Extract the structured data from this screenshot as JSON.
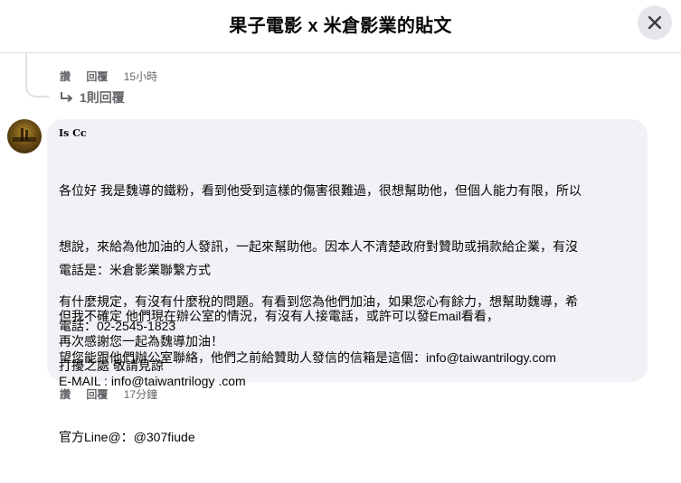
{
  "header": {
    "title": "果子電影 x 米倉影業的貼文"
  },
  "previous_comment": {
    "like_label": "讚",
    "reply_label": "回覆",
    "time": "15小時",
    "replies_link": "1則回覆"
  },
  "comment": {
    "author": "Is Cc",
    "paragraph1_lines": [
      "各位好 我是魏導的鐵粉，看到他受到這樣的傷害很難過，很想幫助他，但個人能力有限，所以",
      "想說，來給為他加油的人發訊，一起來幫助他。因本人不清楚政府對贊助或捐款給企業，有沒",
      "有什麼規定，有沒有什麼稅的問題。有看到您為他們加油，如果您心有餘力，想幫助魏導，希",
      "望您能跟他們辦公室聯絡，他們之前給贊助人發信的信箱是這個：info@taiwantrilogy.com"
    ],
    "contact_lines": [
      "電話是：米倉影業聯繫方式",
      "電話：02-2545-1823",
      "E-MAIL : info@taiwantrilogy .com",
      "官方Line@：@307fiude"
    ],
    "paragraph3": "但我不確定 他們現在辦公室的情況，有沒有人接電話，或許可以發Email看看，",
    "paragraph4": "再次感謝您一起為魏導加油！",
    "paragraph5": "打擾之處 敬請見諒",
    "like_label": "讚",
    "reply_label": "回覆",
    "time": "17分鐘"
  },
  "icons": {
    "close": "close-icon",
    "reply_arrow": "reply-arrow-icon",
    "avatar": "avatar"
  }
}
